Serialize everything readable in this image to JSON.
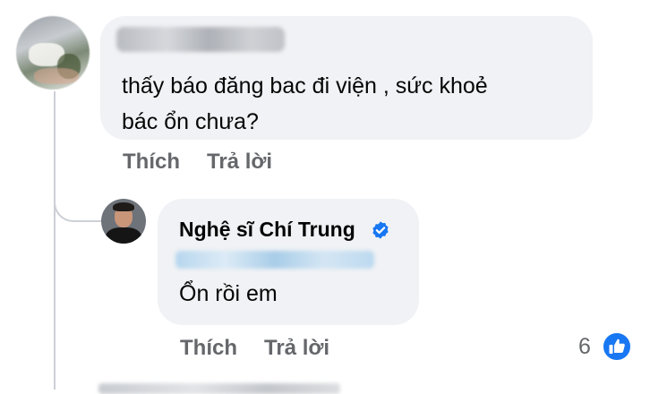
{
  "comment1": {
    "text": "thấy báo đăng bac đi viện , sức khoẻ\nbác ổn chưa?",
    "actions": {
      "like": "Thích",
      "reply": "Trả lời"
    }
  },
  "reply1": {
    "author": "Nghệ sĩ Chí Trung",
    "text": "Ổn rồi em",
    "actions": {
      "like": "Thích",
      "reply": "Trả lời"
    },
    "reaction_count": "6"
  },
  "colors": {
    "bubble": "#f0f2f5",
    "meta_text": "#65676b",
    "accent_blue": "#1877f2"
  }
}
